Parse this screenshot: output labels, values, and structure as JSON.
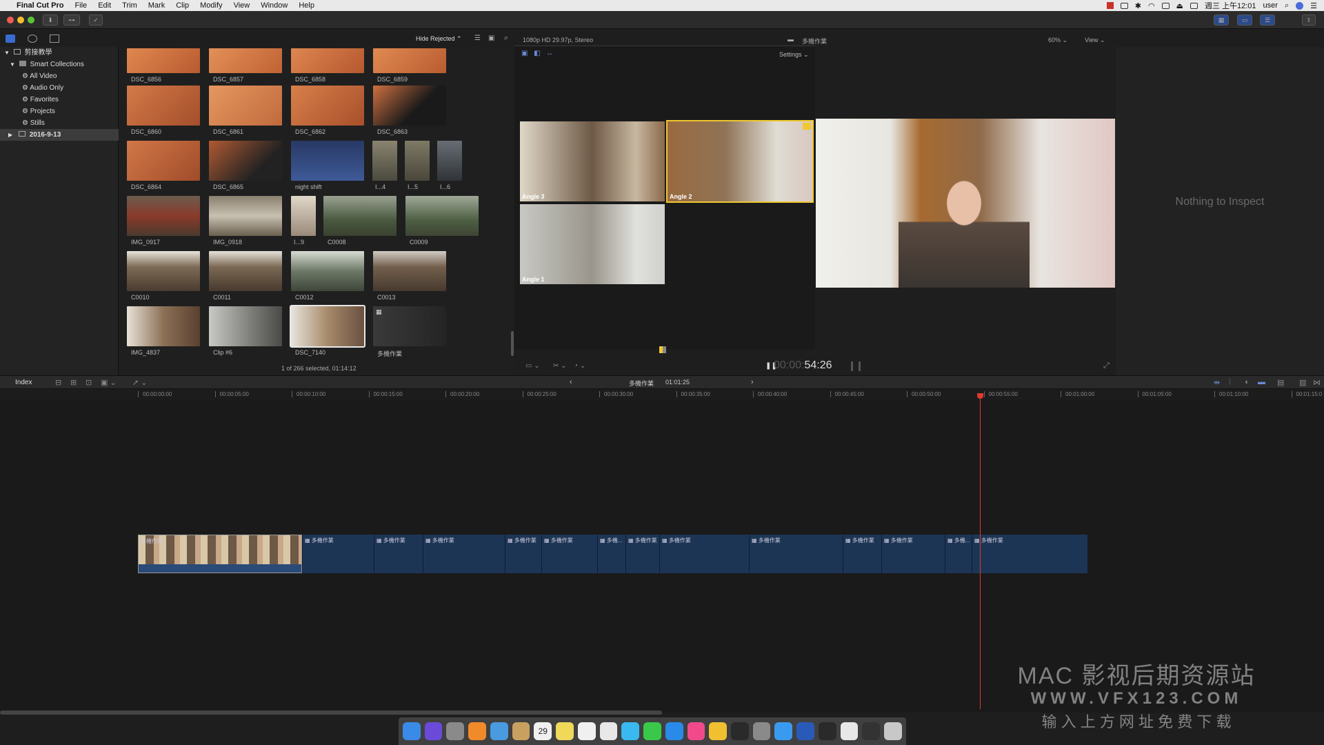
{
  "menubar": {
    "app": "Final Cut Pro",
    "items": [
      "File",
      "Edit",
      "Trim",
      "Mark",
      "Clip",
      "Modify",
      "View",
      "Window",
      "Help"
    ],
    "clock": "週三 上午12:01",
    "user": "user"
  },
  "library": {
    "name": "剪接教學",
    "smart_collections": "Smart Collections",
    "collections": [
      "All Video",
      "Audio Only",
      "Favorites",
      "Projects",
      "Stills"
    ],
    "event": "2016-9-13"
  },
  "browser": {
    "filter": "Hide Rejected",
    "status": "1 of 266 selected, 01:14:12",
    "clips": [
      {
        "name": "DSC_6856",
        "color": "#c86a3a"
      },
      {
        "name": "DSC_6857",
        "color": "#cf7445"
      },
      {
        "name": "DSC_6858",
        "color": "#c9683b"
      },
      {
        "name": "DSC_6859",
        "color": "#cc6d3f"
      },
      {
        "name": "DSC_6860",
        "color": "#b85d33"
      },
      {
        "name": "DSC_6861",
        "color": "#d27a4a"
      },
      {
        "name": "DSC_6862",
        "color": "#c56638"
      },
      {
        "name": "DSC_6863",
        "color": "#b95a30"
      },
      {
        "name": "DSC_6864",
        "color": "#c3653a"
      },
      {
        "name": "DSC_6865",
        "color": "#a44f2c"
      },
      {
        "name": "night shift",
        "color": "#2d3c66"
      },
      {
        "name": "I...4",
        "color": "#8a8470"
      },
      {
        "name": "I...5",
        "color": "#7e7a66"
      },
      {
        "name": "I...6",
        "color": "#676d74"
      },
      {
        "name": "IMG_0917",
        "color": "#6c5d4f"
      },
      {
        "name": "IMG_0918",
        "color": "#8a8070"
      },
      {
        "name": "I...9",
        "color": "#9a8a7a"
      },
      {
        "name": "C0008",
        "color": "#5a6652"
      },
      {
        "name": "C0009",
        "color": "#66705e"
      },
      {
        "name": "C0010",
        "color": "#7c6a55"
      },
      {
        "name": "C0011",
        "color": "#7a6853"
      },
      {
        "name": "C0012",
        "color": "#6d7866"
      },
      {
        "name": "C0013",
        "color": "#735f4c"
      },
      {
        "name": "IMG_4837",
        "color": "#8c7055"
      },
      {
        "name": "Clip #6",
        "color": "#9a9a98"
      },
      {
        "name": "DSC_7140",
        "color": "#a78a6a"
      },
      {
        "name": "多機作業",
        "color": "#2e2e2e"
      }
    ]
  },
  "viewer": {
    "format": "1080p HD 29.97p, Stereo",
    "clip_title": "多機作業",
    "zoom": "60%",
    "view_label": "View",
    "settings_label": "Settings",
    "angles": [
      {
        "label": "Angle 3",
        "color": "#6e5846"
      },
      {
        "label": "Angle 2",
        "color": "#8f7356"
      },
      {
        "label": "Angle 1",
        "color": "#9a958c"
      }
    ],
    "timecode_dim": "00:00:",
    "timecode": "54:26"
  },
  "inspector": {
    "empty_text": "Nothing to Inspect"
  },
  "timeline": {
    "index_label": "Index",
    "project_name": "多機作業",
    "duration": "01:01:25",
    "ruler": [
      "00:00:00:00",
      "00:00:05:00",
      "00:00:10:00",
      "00:00:15:00",
      "00:00:20:00",
      "00:00:25:00",
      "00:00:30:00",
      "00:00:35:00",
      "00:00:40:00",
      "00:00:45:00",
      "00:00:50:00",
      "00:00:55:00",
      "00:01:00:00",
      "00:01:05:00",
      "00:01:10:00",
      "00:01:15:0"
    ],
    "segments": [
      "多機作業",
      "多機作業",
      "多機作業",
      "多機作業",
      "多機作業",
      "多機作業",
      "多機...",
      "多機作業",
      "多機作業",
      "多機作業",
      "多機作業",
      "多機作業",
      "多機...",
      "多機作業"
    ]
  },
  "watermark": {
    "line1": "MAC 影视后期资源站",
    "line2": "WWW.VFX123.COM",
    "line3": "输 入 上 方 网 址   免 费 下 载"
  },
  "dock": {
    "icons": [
      "finder-icon",
      "siri-icon",
      "launchpad-icon",
      "books-icon",
      "preview-icon",
      "notes-icon",
      "calendar-icon",
      "stickies-icon",
      "reminders-icon",
      "photos-icon",
      "messages-icon",
      "facetime-icon",
      "app-store-icon",
      "itunes-icon",
      "photos-app-icon",
      "final-cut-icon",
      "system-preferences-icon",
      "safari-icon",
      "quicktime-icon",
      "terminal-icon",
      "folder-icon",
      "display-icon",
      "trash-icon"
    ],
    "calendar_day": "29"
  }
}
